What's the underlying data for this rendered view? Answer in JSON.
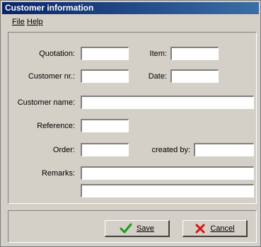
{
  "window": {
    "title": "Customer information"
  },
  "menu": {
    "file": "File",
    "help": "Help"
  },
  "form": {
    "quotation_label": "Quotation:",
    "item_label": "Item:",
    "customer_nr_label": "Customer nr.:",
    "date_label": "Date:",
    "customer_name_label": "Customer name:",
    "reference_label": "Reference:",
    "order_label": "Order:",
    "created_by_label": "created by:",
    "remarks_label": "Remarks:",
    "quotation_value": "",
    "item_value": "",
    "customer_nr_value": "",
    "date_value": "",
    "customer_name_value": "",
    "reference_value": "",
    "order_value": "",
    "created_by_value": "",
    "remarks_line1_value": "",
    "remarks_line2_value": ""
  },
  "buttons": {
    "save": "Save",
    "cancel": "Cancel"
  },
  "icons": {
    "save": "check-icon",
    "cancel": "x-icon"
  },
  "colors": {
    "title_bar": "#0a246a",
    "check": "#1e9a1e",
    "x": "#e01010",
    "window_bg": "#d4d0c8"
  }
}
